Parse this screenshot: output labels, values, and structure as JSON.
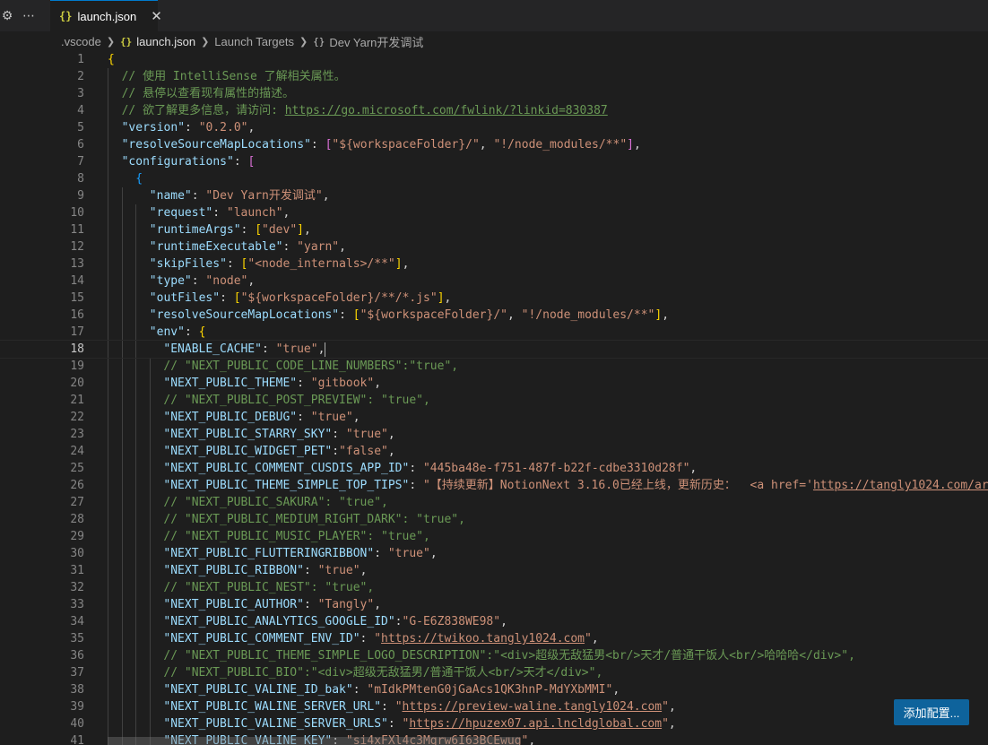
{
  "tab": {
    "label": "launch.json",
    "icon": "json-file-icon"
  },
  "breadcrumb": [
    ".vscode",
    "launch.json",
    "Launch Targets",
    "Dev Yarn开发调试"
  ],
  "breadcrumb_icons": {
    "json": "{}",
    "object": "{}"
  },
  "current_line": 18,
  "button": {
    "label": "添加配置..."
  },
  "lines": [
    {
      "n": "1",
      "indent": 0,
      "t": [
        [
          "b1",
          "{"
        ]
      ]
    },
    {
      "n": "2",
      "indent": 1,
      "t": [
        [
          "c",
          "// 使用 IntelliSense 了解相关属性。"
        ]
      ]
    },
    {
      "n": "3",
      "indent": 1,
      "t": [
        [
          "c",
          "// 悬停以查看现有属性的描述。"
        ]
      ]
    },
    {
      "n": "4",
      "indent": 1,
      "t": [
        [
          "c",
          "// 欲了解更多信息，请访问: "
        ],
        [
          "cu",
          "https://go.microsoft.com/fwlink/?linkid=830387"
        ]
      ]
    },
    {
      "n": "5",
      "indent": 1,
      "t": [
        [
          "k",
          "\"version\""
        ],
        [
          "p",
          ": "
        ],
        [
          "s",
          "\"0.2.0\""
        ],
        [
          "p",
          ","
        ]
      ]
    },
    {
      "n": "6",
      "indent": 1,
      "t": [
        [
          "k",
          "\"resolveSourceMapLocations\""
        ],
        [
          "p",
          ": "
        ],
        [
          "b2",
          "["
        ],
        [
          "s",
          "\"${workspaceFolder}/\""
        ],
        [
          "p",
          ", "
        ],
        [
          "s",
          "\"!/node_modules/**\""
        ],
        [
          "b2",
          "]"
        ],
        [
          "p",
          ","
        ]
      ]
    },
    {
      "n": "7",
      "indent": 1,
      "t": [
        [
          "k",
          "\"configurations\""
        ],
        [
          "p",
          ": "
        ],
        [
          "b2",
          "["
        ]
      ]
    },
    {
      "n": "8",
      "indent": 2,
      "t": [
        [
          "b3",
          "{"
        ]
      ]
    },
    {
      "n": "9",
      "indent": 3,
      "t": [
        [
          "k",
          "\"name\""
        ],
        [
          "p",
          ": "
        ],
        [
          "s",
          "\"Dev Yarn开发调试\""
        ],
        [
          "p",
          ","
        ]
      ]
    },
    {
      "n": "10",
      "indent": 3,
      "t": [
        [
          "k",
          "\"request\""
        ],
        [
          "p",
          ": "
        ],
        [
          "s",
          "\"launch\""
        ],
        [
          "p",
          ","
        ]
      ]
    },
    {
      "n": "11",
      "indent": 3,
      "t": [
        [
          "k",
          "\"runtimeArgs\""
        ],
        [
          "p",
          ": "
        ],
        [
          "b1",
          "["
        ],
        [
          "s",
          "\"dev\""
        ],
        [
          "b1",
          "]"
        ],
        [
          "p",
          ","
        ]
      ]
    },
    {
      "n": "12",
      "indent": 3,
      "t": [
        [
          "k",
          "\"runtimeExecutable\""
        ],
        [
          "p",
          ": "
        ],
        [
          "s",
          "\"yarn\""
        ],
        [
          "p",
          ","
        ]
      ]
    },
    {
      "n": "13",
      "indent": 3,
      "t": [
        [
          "k",
          "\"skipFiles\""
        ],
        [
          "p",
          ": "
        ],
        [
          "b1",
          "["
        ],
        [
          "s",
          "\"<node_internals>/**\""
        ],
        [
          "b1",
          "]"
        ],
        [
          "p",
          ","
        ]
      ]
    },
    {
      "n": "14",
      "indent": 3,
      "t": [
        [
          "k",
          "\"type\""
        ],
        [
          "p",
          ": "
        ],
        [
          "s",
          "\"node\""
        ],
        [
          "p",
          ","
        ]
      ]
    },
    {
      "n": "15",
      "indent": 3,
      "t": [
        [
          "k",
          "\"outFiles\""
        ],
        [
          "p",
          ": "
        ],
        [
          "b1",
          "["
        ],
        [
          "s",
          "\"${workspaceFolder}/**/*.js\""
        ],
        [
          "b1",
          "]"
        ],
        [
          "p",
          ","
        ]
      ]
    },
    {
      "n": "16",
      "indent": 3,
      "t": [
        [
          "k",
          "\"resolveSourceMapLocations\""
        ],
        [
          "p",
          ": "
        ],
        [
          "b1",
          "["
        ],
        [
          "s",
          "\"${workspaceFolder}/\""
        ],
        [
          "p",
          ", "
        ],
        [
          "s",
          "\"!/node_modules/**\""
        ],
        [
          "b1",
          "]"
        ],
        [
          "p",
          ","
        ]
      ]
    },
    {
      "n": "17",
      "indent": 3,
      "t": [
        [
          "k",
          "\"env\""
        ],
        [
          "p",
          ": "
        ],
        [
          "b1",
          "{"
        ]
      ]
    },
    {
      "n": "18",
      "indent": 4,
      "t": [
        [
          "k",
          "\"ENABLE_CACHE\""
        ],
        [
          "p",
          ": "
        ],
        [
          "s",
          "\"true\""
        ],
        [
          "p",
          ","
        ]
      ]
    },
    {
      "n": "19",
      "indent": 4,
      "t": [
        [
          "c",
          "// \"NEXT_PUBLIC_CODE_LINE_NUMBERS\":\"true\","
        ]
      ]
    },
    {
      "n": "20",
      "indent": 4,
      "t": [
        [
          "k",
          "\"NEXT_PUBLIC_THEME\""
        ],
        [
          "p",
          ": "
        ],
        [
          "s",
          "\"gitbook\""
        ],
        [
          "p",
          ","
        ]
      ]
    },
    {
      "n": "21",
      "indent": 4,
      "t": [
        [
          "c",
          "// \"NEXT_PUBLIC_POST_PREVIEW\": \"true\","
        ]
      ]
    },
    {
      "n": "22",
      "indent": 4,
      "t": [
        [
          "k",
          "\"NEXT_PUBLIC_DEBUG\""
        ],
        [
          "p",
          ": "
        ],
        [
          "s",
          "\"true\""
        ],
        [
          "p",
          ","
        ]
      ]
    },
    {
      "n": "23",
      "indent": 4,
      "t": [
        [
          "k",
          "\"NEXT_PUBLIC_STARRY_SKY\""
        ],
        [
          "p",
          ": "
        ],
        [
          "s",
          "\"true\""
        ],
        [
          "p",
          ","
        ]
      ]
    },
    {
      "n": "24",
      "indent": 4,
      "t": [
        [
          "k",
          "\"NEXT_PUBLIC_WIDGET_PET\""
        ],
        [
          "p",
          ":"
        ],
        [
          "s",
          "\"false\""
        ],
        [
          "p",
          ","
        ]
      ]
    },
    {
      "n": "25",
      "indent": 4,
      "t": [
        [
          "k",
          "\"NEXT_PUBLIC_COMMENT_CUSDIS_APP_ID\""
        ],
        [
          "p",
          ": "
        ],
        [
          "s",
          "\"445ba48e-f751-487f-b22f-cdbe3310d28f\""
        ],
        [
          "p",
          ","
        ]
      ]
    },
    {
      "n": "26",
      "indent": 4,
      "t": [
        [
          "k",
          "\"NEXT_PUBLIC_THEME_SIMPLE_TOP_TIPS\""
        ],
        [
          "p",
          ": "
        ],
        [
          "s",
          "\"【持续更新】NotionNext 3.16.0已经上线，更新历史：  <a href='"
        ],
        [
          "su",
          "https://tangly1024.com/ar"
        ]
      ]
    },
    {
      "n": "27",
      "indent": 4,
      "t": [
        [
          "c",
          "// \"NEXT_PUBLIC_SAKURA\": \"true\","
        ]
      ]
    },
    {
      "n": "28",
      "indent": 4,
      "t": [
        [
          "c",
          "// \"NEXT_PUBLIC_MEDIUM_RIGHT_DARK\": \"true\","
        ]
      ]
    },
    {
      "n": "29",
      "indent": 4,
      "t": [
        [
          "c",
          "// \"NEXT_PUBLIC_MUSIC_PLAYER\": \"true\","
        ]
      ]
    },
    {
      "n": "30",
      "indent": 4,
      "t": [
        [
          "k",
          "\"NEXT_PUBLIC_FLUTTERINGRIBBON\""
        ],
        [
          "p",
          ": "
        ],
        [
          "s",
          "\"true\""
        ],
        [
          "p",
          ","
        ]
      ]
    },
    {
      "n": "31",
      "indent": 4,
      "t": [
        [
          "k",
          "\"NEXT_PUBLIC_RIBBON\""
        ],
        [
          "p",
          ": "
        ],
        [
          "s",
          "\"true\""
        ],
        [
          "p",
          ","
        ]
      ]
    },
    {
      "n": "32",
      "indent": 4,
      "t": [
        [
          "c",
          "// \"NEXT_PUBLIC_NEST\": \"true\","
        ]
      ]
    },
    {
      "n": "33",
      "indent": 4,
      "t": [
        [
          "k",
          "\"NEXT_PUBLIC_AUTHOR\""
        ],
        [
          "p",
          ": "
        ],
        [
          "s",
          "\"Tangly\""
        ],
        [
          "p",
          ","
        ]
      ]
    },
    {
      "n": "34",
      "indent": 4,
      "t": [
        [
          "k",
          "\"NEXT_PUBLIC_ANALYTICS_GOOGLE_ID\""
        ],
        [
          "p",
          ":"
        ],
        [
          "s",
          "\"G-E6Z838WE98\""
        ],
        [
          "p",
          ","
        ]
      ]
    },
    {
      "n": "35",
      "indent": 4,
      "t": [
        [
          "k",
          "\"NEXT_PUBLIC_COMMENT_ENV_ID\""
        ],
        [
          "p",
          ": "
        ],
        [
          "s",
          "\""
        ],
        [
          "su",
          "https://twikoo.tangly1024.com"
        ],
        [
          "s",
          "\""
        ],
        [
          "p",
          ","
        ]
      ]
    },
    {
      "n": "36",
      "indent": 4,
      "t": [
        [
          "c",
          "// \"NEXT_PUBLIC_THEME_SIMPLE_LOGO_DESCRIPTION\":\"<div>超级无敌猛男<br/>天才/普通干饭人<br/>哈哈哈</div>\","
        ]
      ]
    },
    {
      "n": "37",
      "indent": 4,
      "t": [
        [
          "c",
          "// \"NEXT_PUBLIC_BIO\":\"<div>超级无敌猛男/普通干饭人<br/>天才</div>\","
        ]
      ]
    },
    {
      "n": "38",
      "indent": 4,
      "t": [
        [
          "k",
          "\"NEXT_PUBLIC_VALINE_ID_bak\""
        ],
        [
          "p",
          ": "
        ],
        [
          "s",
          "\"mIdkPMtenG0jGaAcs1QK3hnP-MdYXbMMI\""
        ],
        [
          "p",
          ","
        ]
      ]
    },
    {
      "n": "39",
      "indent": 4,
      "t": [
        [
          "k",
          "\"NEXT_PUBLIC_WALINE_SERVER_URL\""
        ],
        [
          "p",
          ": "
        ],
        [
          "s",
          "\""
        ],
        [
          "su",
          "https://preview-waline.tangly1024.com"
        ],
        [
          "s",
          "\""
        ],
        [
          "p",
          ","
        ]
      ]
    },
    {
      "n": "40",
      "indent": 4,
      "t": [
        [
          "k",
          "\"NEXT_PUBLIC_VALINE_SERVER_URLS\""
        ],
        [
          "p",
          ": "
        ],
        [
          "s",
          "\""
        ],
        [
          "su",
          "https://hpuzex07.api.lncldglobal.com"
        ],
        [
          "s",
          "\""
        ],
        [
          "p",
          ","
        ]
      ]
    },
    {
      "n": "41",
      "indent": 4,
      "t": [
        [
          "k",
          "\"NEXT_PUBLIC_VALINE_KEY\""
        ],
        [
          "p",
          ": "
        ],
        [
          "s",
          "\"si4xFXl4c3Mqrw6I63BCEwug\""
        ],
        [
          "p",
          ","
        ]
      ]
    }
  ]
}
